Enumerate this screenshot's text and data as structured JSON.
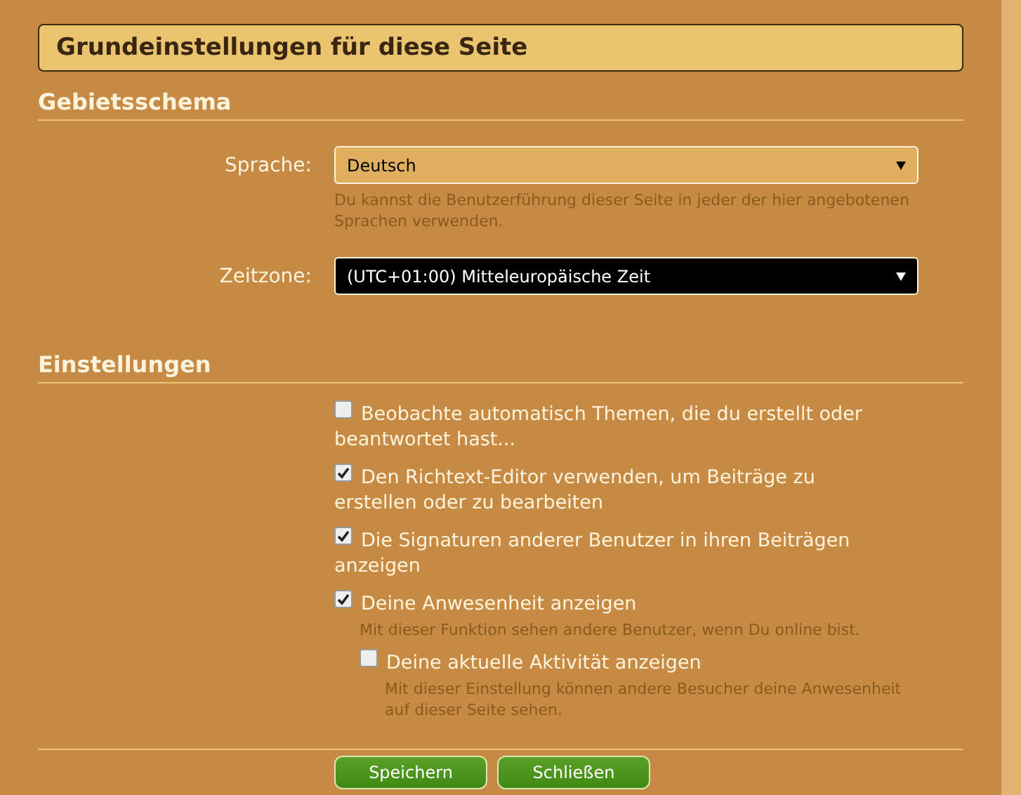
{
  "title": "Grundeinstellungen für diese Seite",
  "locale_section": {
    "heading": "Gebietsschema",
    "fields": [
      {
        "label": "Sprache:",
        "value": "Deutsch",
        "highlighted": false,
        "hint": "Du kannst die Benutzerführung dieser Seite in jeder der hier angebotenen Sprachen verwenden."
      },
      {
        "label": "Zeitzone:",
        "value": "(UTC+01:00) Mitteleuropäische Zeit",
        "highlighted": true
      }
    ]
  },
  "settings_section": {
    "heading": "Einstellungen",
    "options": [
      {
        "label": "Beobachte automatisch Themen, die du erstellt oder beantwortet hast...",
        "checked": false
      },
      {
        "label": "Den Richtext-Editor verwenden, um Beiträge zu erstellen oder zu bearbeiten",
        "checked": true
      },
      {
        "label": "Die Signaturen anderer Benutzer in ihren Beiträgen anzeigen",
        "checked": true
      },
      {
        "label": "Deine Anwesenheit anzeigen",
        "checked": true,
        "hint": "Mit dieser Funktion sehen andere Benutzer, wenn Du online bist.",
        "children": [
          {
            "label": "Deine aktuelle Aktivität anzeigen",
            "checked": false,
            "hint": "Mit dieser Einstellung können andere Besucher deine Anwesenheit auf dieser Seite sehen."
          }
        ]
      }
    ]
  },
  "buttons": [
    "Speichern",
    "Schließen"
  ]
}
